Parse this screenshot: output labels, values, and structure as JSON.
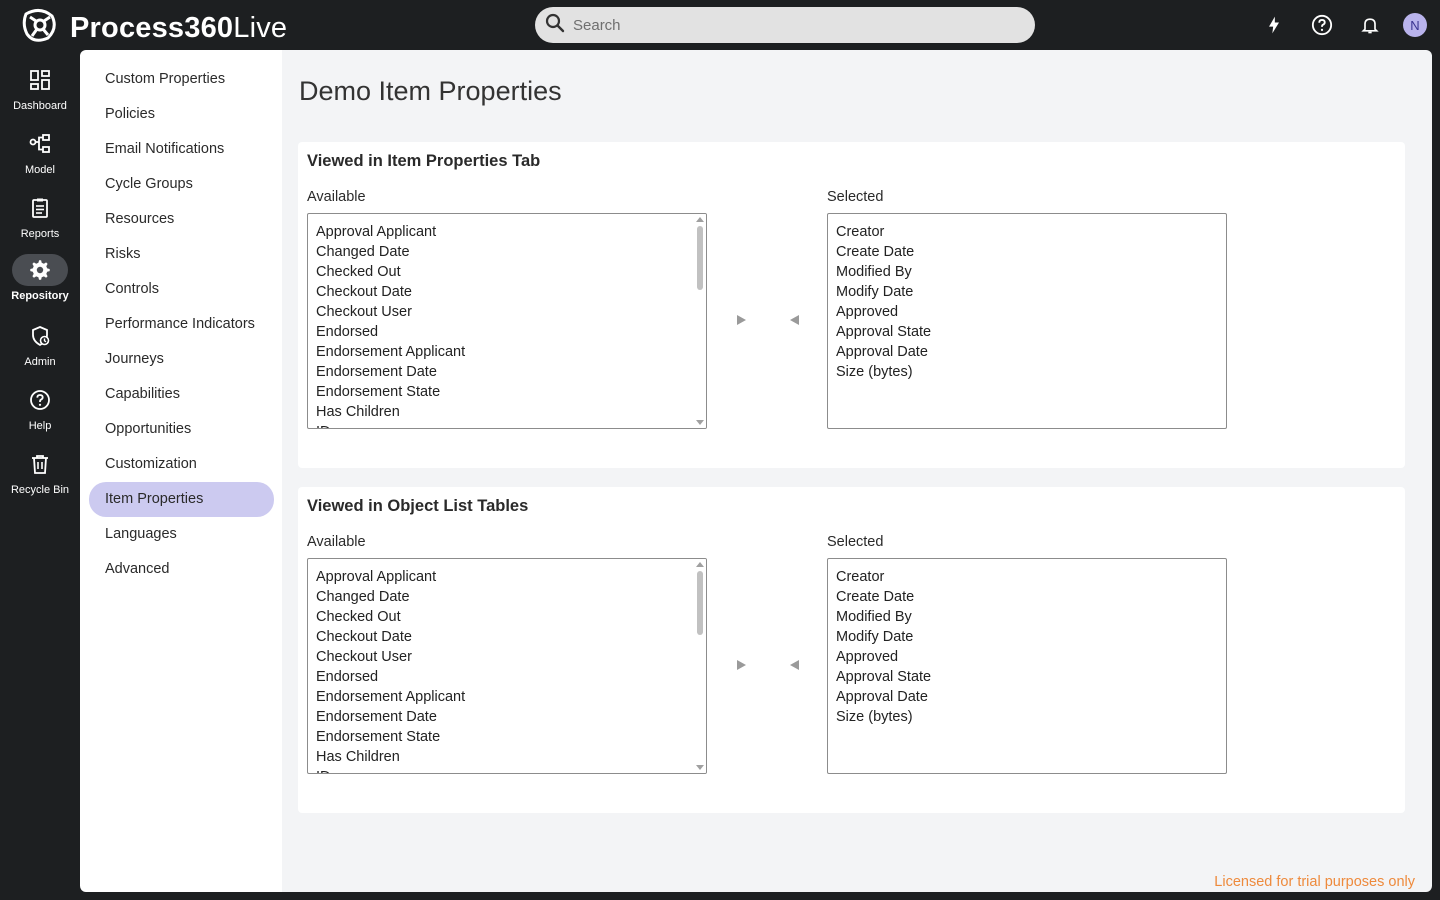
{
  "app": {
    "name_bold": "Process360",
    "name_light": "Live"
  },
  "search": {
    "placeholder": "Search"
  },
  "header_icons": [
    "lightning-icon",
    "help-circle-icon",
    "bell-icon"
  ],
  "user": {
    "initial": "N"
  },
  "rail": {
    "items": [
      {
        "label": "Dashboard",
        "icon": "dashboard-icon"
      },
      {
        "label": "Model",
        "icon": "model-icon"
      },
      {
        "label": "Reports",
        "icon": "reports-icon"
      },
      {
        "label": "Repository",
        "icon": "gear-icon",
        "active": true
      },
      {
        "label": "Admin",
        "icon": "admin-icon"
      },
      {
        "label": "Help",
        "icon": "help-icon"
      },
      {
        "label": "Recycle Bin",
        "icon": "trash-icon"
      }
    ]
  },
  "subnav": {
    "items": [
      "Custom Properties",
      "Policies",
      "Email Notifications",
      "Cycle Groups",
      "Resources",
      "Risks",
      "Controls",
      "Performance Indicators",
      "Journeys",
      "Capabilities",
      "Opportunities",
      "Customization",
      "Item Properties",
      "Languages",
      "Advanced"
    ],
    "active": "Item Properties"
  },
  "page": {
    "title": "Demo Item Properties"
  },
  "sections": [
    {
      "title": "Viewed in Item Properties Tab",
      "available_label": "Available",
      "selected_label": "Selected",
      "available": [
        "Approval Applicant",
        "Changed Date",
        "Checked Out",
        "Checkout Date",
        "Checkout User",
        "Endorsed",
        "Endorsement Applicant",
        "Endorsement Date",
        "Endorsement State",
        "Has Children",
        "ID"
      ],
      "selected": [
        "Creator",
        "Create Date",
        "Modified By",
        "Modify Date",
        "Approved",
        "Approval State",
        "Approval Date",
        "Size (bytes)"
      ]
    },
    {
      "title": "Viewed in Object List Tables",
      "available_label": "Available",
      "selected_label": "Selected",
      "available": [
        "Approval Applicant",
        "Changed Date",
        "Checked Out",
        "Checkout Date",
        "Checkout User",
        "Endorsed",
        "Endorsement Applicant",
        "Endorsement Date",
        "Endorsement State",
        "Has Children",
        "ID"
      ],
      "selected": [
        "Creator",
        "Create Date",
        "Modified By",
        "Modify Date",
        "Approved",
        "Approval State",
        "Approval Date",
        "Size (bytes)"
      ]
    }
  ],
  "footer": {
    "license": "Licensed for trial purposes only"
  },
  "colors": {
    "accent": "#cccaf0",
    "license": "#ee8a3c"
  }
}
